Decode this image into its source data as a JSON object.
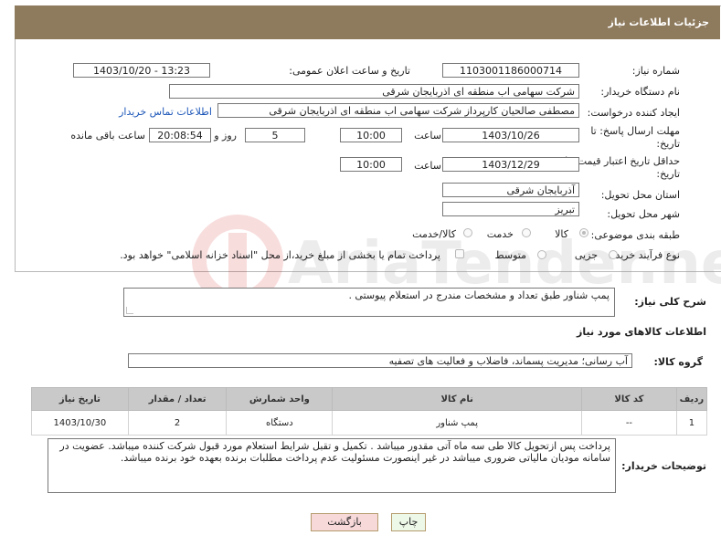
{
  "header": {
    "title": "جزئیات اطلاعات نیاز"
  },
  "fields": {
    "need_number_label": "شماره نیاز:",
    "need_number": "1103001186000714",
    "announce_label": "تاریخ و ساعت اعلان عمومی:",
    "announce_value": "1403/10/20 - 13:23",
    "buyer_org_label": "نام دستگاه خریدار:",
    "buyer_org": "شرکت سهامی اب منطقه ای اذربایجان شرقی",
    "requester_label": "ایجاد کننده درخواست:",
    "requester": "مصطفی صالحیان کارپرداز شرکت سهامی اب منطقه ای اذربایجان شرقی",
    "contact_link": "اطلاعات تماس خریدار",
    "reply_deadline_label": "مهلت ارسال پاسخ: تا",
    "reply_deadline_label2": "تاریخ:",
    "reply_date": "1403/10/26",
    "time_label": "ساعت",
    "reply_time": "10:00",
    "days_value": "5",
    "days_label": "روز و",
    "remaining_time": "20:08:54",
    "remaining_label": "ساعت باقی مانده",
    "price_validity_label": "حداقل تاریخ اعتبار قیمت: تا",
    "price_validity_label2": "تاریخ:",
    "price_date": "1403/12/29",
    "price_time": "10:00",
    "province_label": "استان محل تحویل:",
    "province": "آذربایجان شرقی",
    "city_label": "شهر محل تحویل:",
    "city": "تبریز",
    "category_label": "طبقه بندی موضوعی:",
    "category_options": [
      "کالا",
      "خدمت",
      "کالا/خدمت"
    ],
    "process_label": "نوع فرآیند خرید :",
    "process_options": [
      "جزیی",
      "متوسط"
    ],
    "payment_note": "پرداخت تمام یا بخشی از مبلغ خرید،از محل \"اسناد خزانه اسلامی\" خواهد بود."
  },
  "description": {
    "label": "شرح کلی نیاز:",
    "value": "پمپ شناور طبق تعداد و مشخصات مندرج در استعلام پیوستی ."
  },
  "goods_section": {
    "title": "اطلاعات کالاهای مورد نیاز",
    "group_label": "گروه کالا:",
    "group_value": "آب رسانی؛ مدیریت پسماند، فاضلاب و فعالیت های تصفیه"
  },
  "table": {
    "headers": [
      "ردیف",
      "کد کالا",
      "نام کالا",
      "واحد شمارش",
      "تعداد / مقدار",
      "تاریخ نیاز"
    ],
    "rows": [
      [
        "1",
        "--",
        "پمپ شناور",
        "دستگاه",
        "2",
        "1403/10/30"
      ]
    ]
  },
  "buyer_notes": {
    "label": "توضیحات خریدار:",
    "value": "پرداخت پس ازتحویل کالا طی سه ماه آتی مقدور میباشد . تکمیل و تقبل شرایط استعلام مورد قبول شرکت کننده میباشد. عضویت در سامانه مودیان مالیاتی ضروری میباشد در غیر اینصورت مسئولیت عدم پرداخت مطلبات برنده بعهده خود برنده میباشد."
  },
  "buttons": {
    "print": "چاپ",
    "back": "بازگشت"
  },
  "watermark": {
    "text": "AriaTender.neT"
  },
  "colors": {
    "header_bg": "#8e7a5d",
    "link": "#1d57b8",
    "back_btn_bg": "#f7d9da",
    "print_btn_bg": "#eef8e8"
  }
}
